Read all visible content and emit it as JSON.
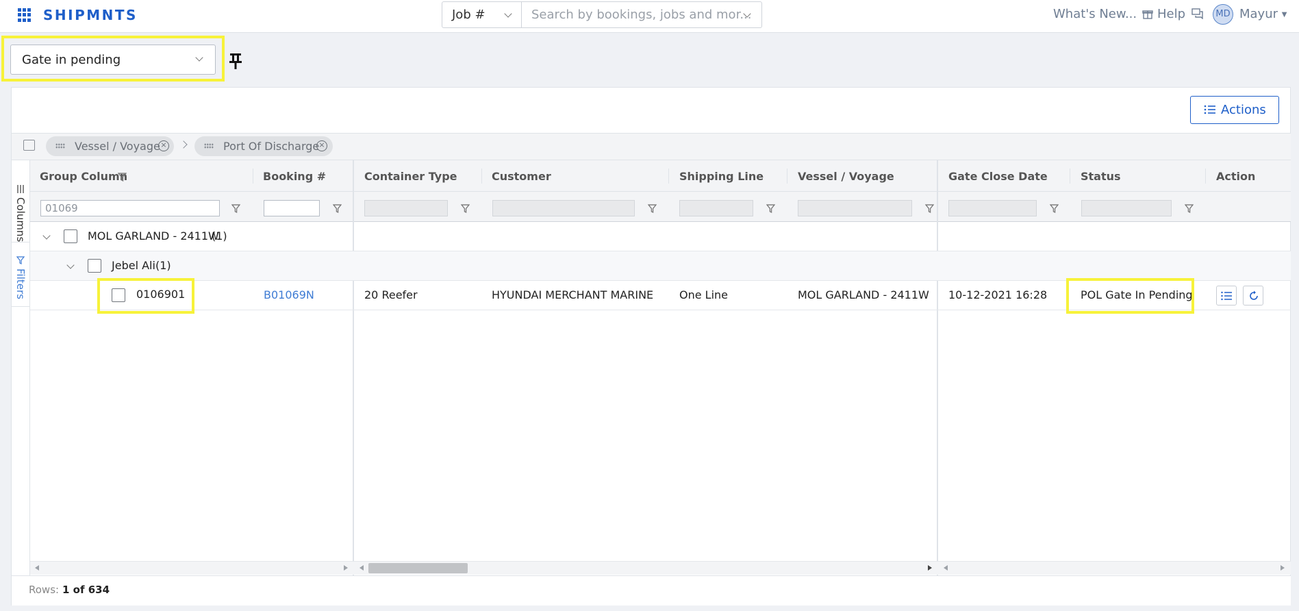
{
  "app": {
    "brand": "SHIPMNTS"
  },
  "topbar": {
    "search_type": "Job #",
    "search_placeholder": "Search by bookings, jobs and mor...",
    "whats_new": "What's New...",
    "help": "Help",
    "user_initials": "MD",
    "user_name": "Mayur"
  },
  "view": {
    "selected": "Gate in pending"
  },
  "toolbar": {
    "actions_label": "Actions"
  },
  "grouping": {
    "groups": [
      "Vessel / Voyage",
      "Port Of Discharge"
    ]
  },
  "side_panel": {
    "columns": "Columns",
    "filters": "Filters"
  },
  "grid": {
    "columns": [
      "Group Column",
      "Booking #",
      "Container Type",
      "Customer",
      "Shipping Line",
      "Vessel / Voyage",
      "Gate Close Date",
      "Status",
      "Action"
    ],
    "group_filter_value": "01069",
    "group_level_1": "MOL GARLAND - 2411W",
    "group_level_1_count": "(1)",
    "group_level_2": "Jebel Ali",
    "group_level_2_count": "(1)",
    "rows": [
      {
        "id": "0106901",
        "booking": "B01069N",
        "container_type": "20 Reefer",
        "customer": "HYUNDAI MERCHANT MARINE",
        "shipping_line": "One Line",
        "vessel_voyage": "MOL GARLAND - 2411W",
        "gate_close_date": "10-12-2021 16:28",
        "status": "POL Gate In Pending"
      }
    ]
  },
  "footer": {
    "rows_label": "Rows:",
    "rows_value": "1 of 634"
  },
  "colors": {
    "accent": "#1f5fc9",
    "highlight": "#f7f23a",
    "link": "#3f7cd4"
  }
}
